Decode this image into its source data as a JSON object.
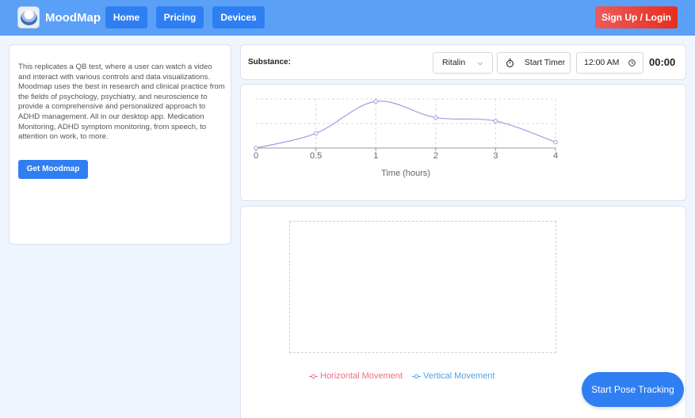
{
  "navbar": {
    "brand": "MoodMap",
    "links": [
      {
        "label": "Home"
      },
      {
        "label": "Pricing"
      },
      {
        "label": "Devices"
      }
    ],
    "signup_label": "Sign Up / Login"
  },
  "intro": {
    "description": "This replicates a QB test, where a user can watch a video and interact with various controls and data visualizations. Moodmap uses the best in research and clinical practice from the fields of psychology, psychiatry, and neuroscience to provide a comprehensive and personalized approach to ADHD management. All in our desktop app. Medication Monitoring, ADHD symptom monitoring, from speech, to attention on work, to more.",
    "cta_label": "Get Moodmap"
  },
  "toolbar": {
    "substance_label": "Substance:",
    "substance_selected": "Ritalin",
    "timer_label": "Start Timer",
    "time_value": "12:00 AM",
    "countdown": "00:00"
  },
  "chart_data": {
    "type": "line",
    "x": [
      0,
      0.5,
      1,
      2,
      3,
      4
    ],
    "series": [
      {
        "values": [
          0,
          0.3,
          0.95,
          0.62,
          0.55,
          0.12
        ]
      }
    ],
    "xlabel": "Time (hours)",
    "ylabel": "",
    "ylim": [
      0,
      1
    ],
    "grid": true,
    "line_color": "#a39be0"
  },
  "pose": {
    "legend_horizontal": "Horizontal Movement",
    "legend_vertical": "Vertical Movement",
    "horizontal_color": "#f06b85",
    "vertical_color": "#4fa3e4",
    "start_label": "Start Pose Tracking"
  }
}
